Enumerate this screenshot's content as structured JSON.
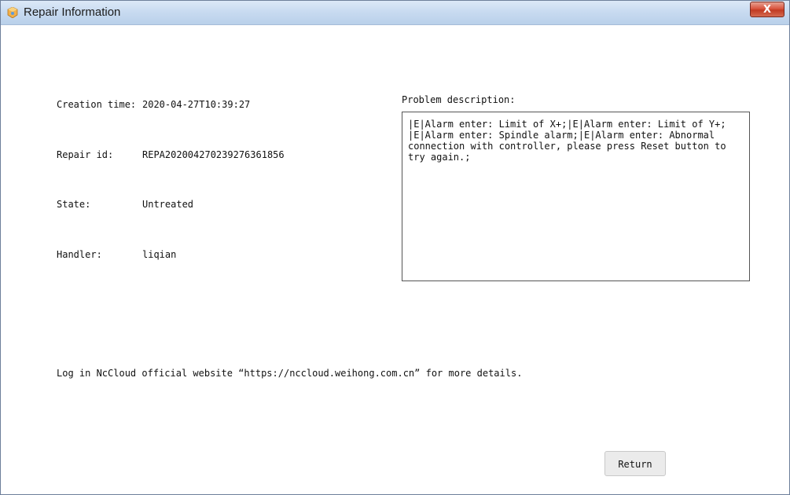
{
  "window": {
    "title": "Repair Information",
    "icon": "app-icon",
    "close_label": "X"
  },
  "info": {
    "creation_label": "Creation time:",
    "creation_value": "2020-04-27T10:39:27",
    "repair_id_label": "Repair id:",
    "repair_id_value": "REPA202004270239276361856",
    "state_label": "State:",
    "state_value": "Untreated",
    "handler_label": "Handler:",
    "handler_value": "liqian"
  },
  "problem": {
    "label": "Problem description:",
    "text": "|E|Alarm enter: Limit of X+;|E|Alarm enter: Limit of Y+;\n|E|Alarm enter: Spindle alarm;|E|Alarm enter: Abnormal connection with controller, please press Reset button to try again.;"
  },
  "footer": {
    "note": "Log in NcCloud official website “https://nccloud.weihong.com.cn” for more details."
  },
  "buttons": {
    "return_label": "Return"
  }
}
